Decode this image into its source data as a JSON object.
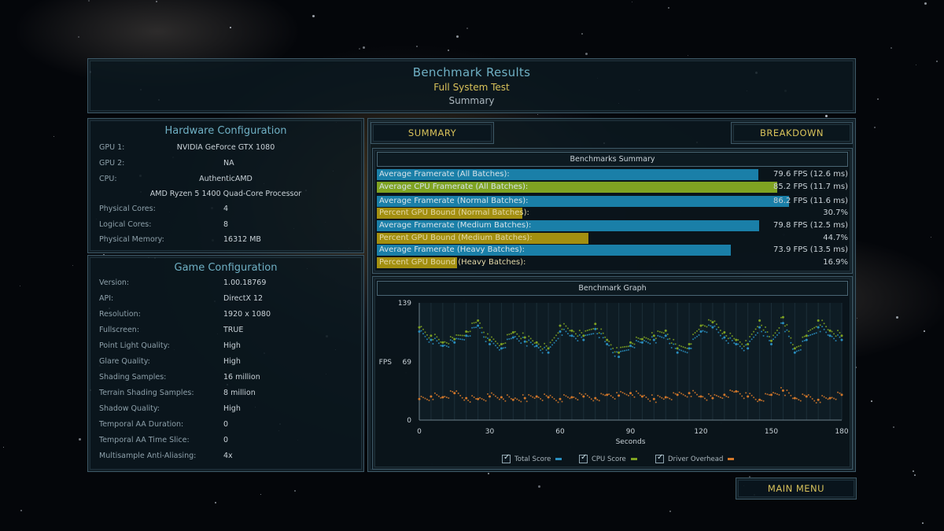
{
  "header": {
    "title": "Benchmark Results",
    "subtitle": "Full System Test",
    "mode": "Summary"
  },
  "hardware": {
    "title": "Hardware Configuration",
    "rows": [
      {
        "label": "GPU 1:",
        "value": "NVIDIA GeForce GTX 1080"
      },
      {
        "label": "GPU 2:",
        "value": "NA"
      },
      {
        "label": "CPU:",
        "value": "AuthenticAMD"
      },
      {
        "label": "",
        "value": "AMD Ryzen 5 1400 Quad-Core Processor"
      },
      {
        "label": "Physical Cores:",
        "value": "4"
      },
      {
        "label": "Logical Cores:",
        "value": "8"
      },
      {
        "label": "Physical Memory:",
        "value": "16312  MB"
      }
    ]
  },
  "game": {
    "title": "Game Configuration",
    "rows": [
      {
        "label": "Version:",
        "value": "1.00.18769"
      },
      {
        "label": "API:",
        "value": "DirectX 12"
      },
      {
        "label": "Resolution:",
        "value": "1920 x 1080"
      },
      {
        "label": "Fullscreen:",
        "value": "TRUE"
      },
      {
        "label": "Point Light Quality:",
        "value": "High"
      },
      {
        "label": "Glare Quality:",
        "value": "High"
      },
      {
        "label": "Shading Samples:",
        "value": "16 million"
      },
      {
        "label": "Terrain Shading Samples:",
        "value": "8 million"
      },
      {
        "label": "Shadow Quality:",
        "value": "High"
      },
      {
        "label": "Temporal AA Duration:",
        "value": "0"
      },
      {
        "label": "Temporal AA Time Slice:",
        "value": "0"
      },
      {
        "label": "Multisample Anti-Aliasing:",
        "value": "4x"
      }
    ]
  },
  "tabs": {
    "summary": "SUMMARY",
    "breakdown": "BREAKDOWN"
  },
  "summary": {
    "title": "Benchmarks Summary",
    "rows": [
      {
        "label": "Average Framerate (All Batches):",
        "value": "79.6 FPS (12.6 ms)",
        "fraction": 0.805,
        "color": "#1a7fa8"
      },
      {
        "label": "Average CPU Framerate (All Batches):",
        "value": "85.2 FPS (11.7 ms)",
        "fraction": 0.845,
        "color": "#7fa322"
      },
      {
        "label": "Average Framerate (Normal Batches):",
        "value": "86.2 FPS (11.6 ms)",
        "fraction": 0.87,
        "color": "#1a7fa8"
      },
      {
        "label": "Percent GPU Bound (Normal Batches):",
        "value": "30.7%",
        "fraction": 0.307,
        "color": "#a38f10"
      },
      {
        "label": "Average Framerate (Medium Batches):",
        "value": "79.8 FPS (12.5 ms)",
        "fraction": 0.808,
        "color": "#1a7fa8"
      },
      {
        "label": "Percent GPU Bound (Medium Batches):",
        "value": "44.7%",
        "fraction": 0.447,
        "color": "#a38f10"
      },
      {
        "label": "Average Framerate (Heavy Batches):",
        "value": "73.9 FPS (13.5 ms)",
        "fraction": 0.748,
        "color": "#1a7fa8"
      },
      {
        "label": "Percent GPU Bound (Heavy Batches):",
        "value": "16.9%",
        "fraction": 0.169,
        "color": "#a38f10"
      }
    ]
  },
  "graph": {
    "title": "Benchmark Graph"
  },
  "chart_data": {
    "type": "scatter",
    "ylabel": "FPS",
    "xlabel": "Seconds",
    "ylim": [
      0,
      139
    ],
    "xlim": [
      0,
      180
    ],
    "y_ticks": [
      "0",
      "69",
      "139"
    ],
    "x_ticks": [
      "0",
      "30",
      "60",
      "90",
      "120",
      "150",
      "180"
    ],
    "series": [
      {
        "name": "Total Score",
        "color": "#2a8fc0",
        "x": [
          0,
          5,
          10,
          15,
          20,
          25,
          30,
          35,
          40,
          45,
          50,
          55,
          60,
          65,
          70,
          75,
          80,
          85,
          90,
          95,
          100,
          105,
          110,
          115,
          120,
          125,
          130,
          135,
          140,
          145,
          150,
          155,
          160,
          165,
          170,
          175,
          180
        ],
        "y": [
          105,
          95,
          88,
          92,
          100,
          112,
          90,
          85,
          98,
          93,
          88,
          80,
          105,
          100,
          95,
          108,
          90,
          75,
          88,
          92,
          95,
          100,
          80,
          85,
          105,
          110,
          98,
          90,
          85,
          110,
          90,
          115,
          80,
          95,
          110,
          100,
          95
        ]
      },
      {
        "name": "CPU Score",
        "color": "#7fa322",
        "x": [
          0,
          5,
          10,
          15,
          20,
          25,
          30,
          35,
          40,
          45,
          50,
          55,
          60,
          65,
          70,
          75,
          80,
          85,
          90,
          95,
          100,
          105,
          110,
          115,
          120,
          125,
          130,
          135,
          140,
          145,
          150,
          155,
          160,
          165,
          170,
          175,
          180
        ],
        "y": [
          110,
          100,
          92,
          96,
          105,
          118,
          95,
          90,
          104,
          98,
          92,
          85,
          112,
          106,
          100,
          114,
          95,
          80,
          92,
          96,
          100,
          106,
          85,
          90,
          112,
          116,
          104,
          95,
          90,
          118,
          94,
          122,
          85,
          100,
          118,
          106,
          100
        ]
      },
      {
        "name": "Driver Overhead",
        "color": "#d4782a",
        "x": [
          0,
          5,
          10,
          15,
          20,
          25,
          30,
          35,
          40,
          45,
          50,
          55,
          60,
          65,
          70,
          75,
          80,
          85,
          90,
          95,
          100,
          105,
          110,
          115,
          120,
          125,
          130,
          135,
          140,
          145,
          150,
          155,
          160,
          165,
          170,
          175,
          180
        ],
        "y": [
          25,
          28,
          27,
          32,
          26,
          25,
          28,
          27,
          24,
          26,
          28,
          27,
          25,
          27,
          28,
          26,
          30,
          29,
          32,
          28,
          25,
          27,
          30,
          32,
          28,
          26,
          30,
          34,
          28,
          24,
          30,
          35,
          26,
          28,
          24,
          26,
          30
        ]
      }
    ],
    "legend": "bottom"
  },
  "legend": [
    {
      "label": "Total Score",
      "color": "#2a8fc0"
    },
    {
      "label": "CPU Score",
      "color": "#7fa322"
    },
    {
      "label": "Driver Overhead",
      "color": "#d4782a"
    }
  ],
  "main_menu": "MAIN MENU"
}
